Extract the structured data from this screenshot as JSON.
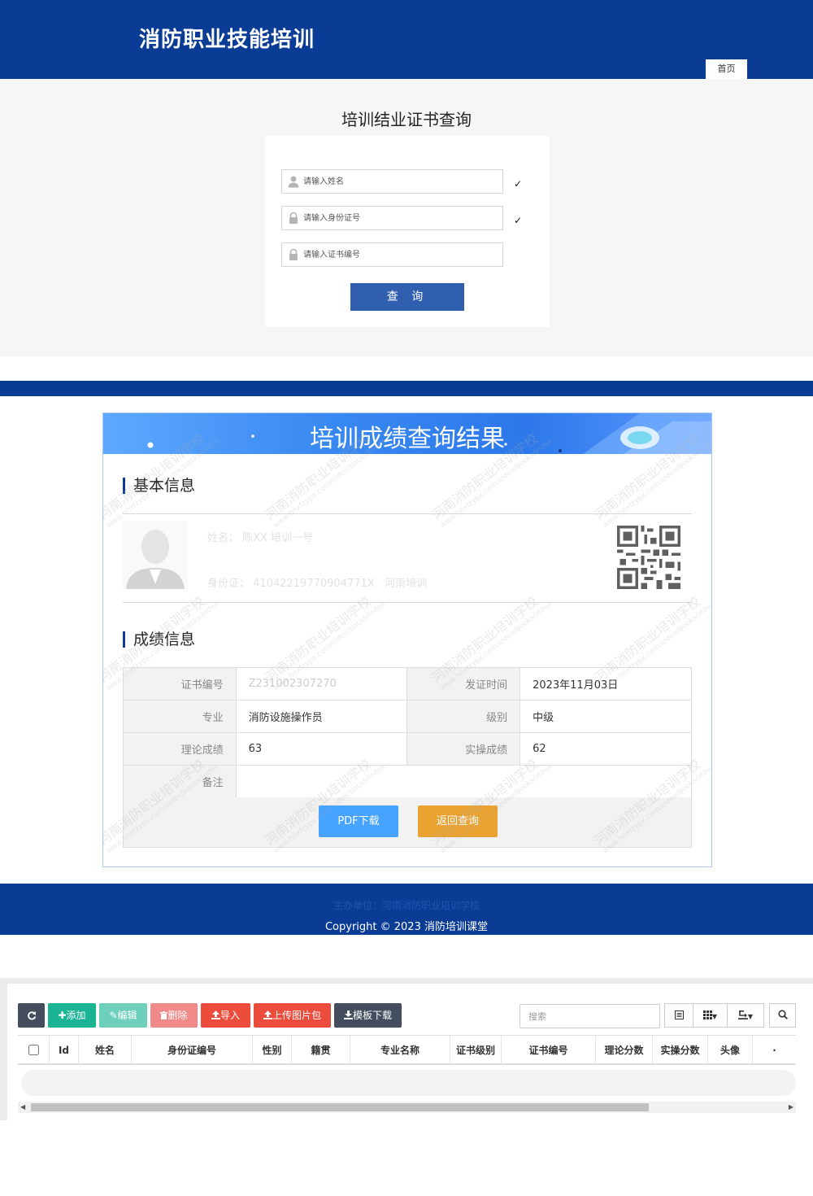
{
  "header": {
    "site_title": "消防职业技能培训",
    "home_tab": "首页"
  },
  "query": {
    "title": "培训结业证书查询",
    "name_placeholder": "请输入姓名",
    "id_placeholder": "请输入身份证号",
    "cert_placeholder": "请输入证书编号",
    "check_mark": "✓",
    "submit_label": "查 询"
  },
  "result": {
    "banner_title": "培训成绩查询结果",
    "basic_heading": "基本信息",
    "basic": {
      "name_label": "姓名",
      "name_value": "陈XX 培训一号",
      "id_label": "身份证",
      "id_value": "41042219770904771X",
      "id_extra": "河南培训"
    },
    "grade_heading": "成绩信息",
    "grades": {
      "cert_no_label": "证书编号",
      "cert_no_value": "Z231002307270",
      "issue_date_label": "发证时间",
      "issue_date_value": "2023年11月03日",
      "major_label": "专业",
      "major_value": "消防设施操作员",
      "level_label": "级别",
      "level_value": "中级",
      "theory_label": "理论成绩",
      "theory_value": "63",
      "practice_label": "实操成绩",
      "practice_value": "62",
      "remark_label": "备注",
      "remark_value": ""
    },
    "pdf_button": "PDF下载",
    "back_button": "返回查询",
    "watermark_text": "河南消防职业培训学校",
    "watermark_url": "www.hnxfzypx.com/index/books/index"
  },
  "footer": {
    "sponsor": "主办单位：河南消防职业培训学校",
    "copyright": "Copyright © 2023 消防培训课堂"
  },
  "admin": {
    "toolbar": {
      "add": "添加",
      "edit": "编辑",
      "delete": "删除",
      "import": "导入",
      "upload_photos": "上传图片包",
      "template_download": "模板下载"
    },
    "search_placeholder": "搜索",
    "columns": [
      "Id",
      "姓名",
      "身份证编号",
      "性别",
      "籍贯",
      "专业名称",
      "证书级别",
      "证书编号",
      "理论分数",
      "实操分数",
      "头像",
      "·"
    ]
  },
  "colors": {
    "brand_blue": "#0a3c96",
    "query_button": "#2f5fae",
    "pdf_button": "#46a3ff",
    "back_button": "#eaa230",
    "btn_refresh": "#444d5e",
    "btn_add": "#1ab394",
    "btn_edit": "#6fcfbd",
    "btn_delete": "#f08a88",
    "btn_import": "#eb4c3c",
    "btn_upload": "#eb4c3c",
    "btn_template": "#444d5e"
  }
}
